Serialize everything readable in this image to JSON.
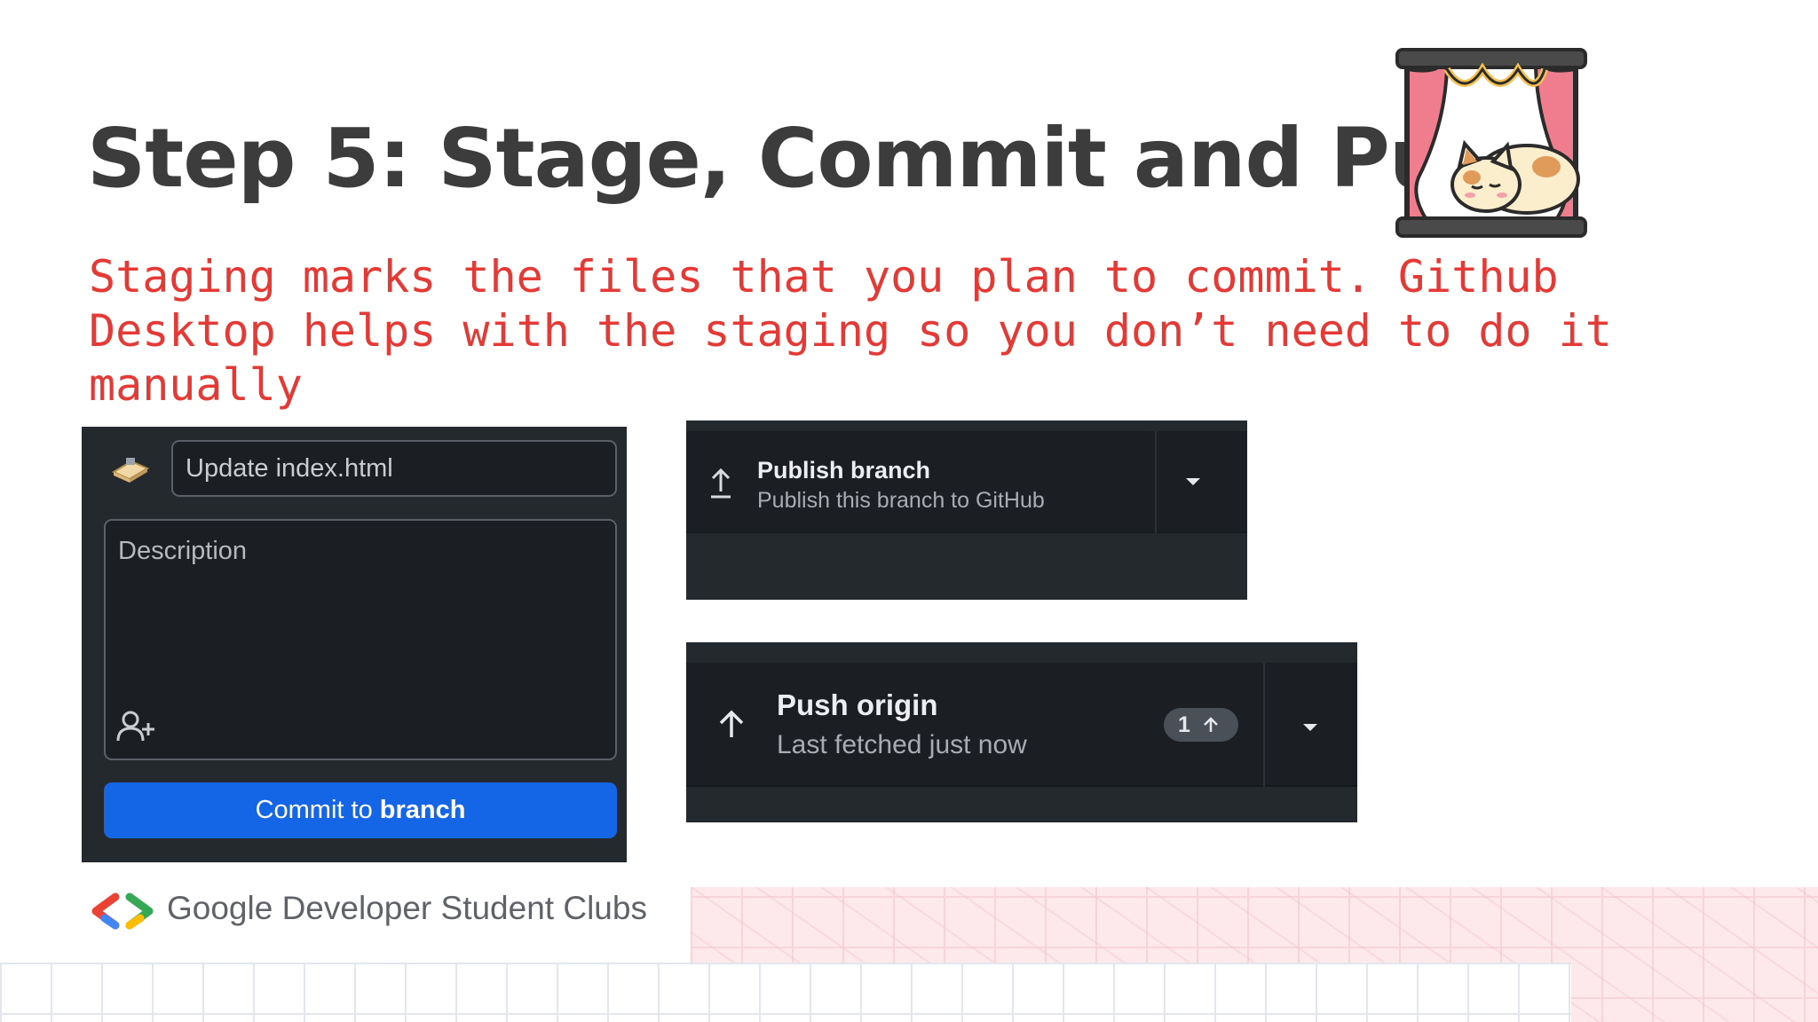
{
  "slide": {
    "title": "Step 5: Stage, Commit and Push",
    "subtitle": "Staging marks the files that you plan to commit. Github Desktop helps with the staging so you don’t need to do it manually"
  },
  "commit_panel": {
    "summary_value": "Update index.html",
    "description_placeholder": "Description",
    "commit_button_prefix": "Commit to ",
    "commit_button_branch": "branch",
    "accent": "#1466e6"
  },
  "publish_panel": {
    "title": "Publish branch",
    "subtitle": "Publish this branch to GitHub"
  },
  "push_panel": {
    "title": "Push origin",
    "subtitle": "Last fetched just now",
    "badge_count": "1"
  },
  "footer": {
    "brand": "Google Developer Student Clubs"
  },
  "icons": [
    "tool-icon",
    "add-coauthor-icon",
    "upload-icon",
    "chevron-down-icon",
    "arrow-up-icon",
    "gdsc-logo-icon",
    "cat-window-illustration"
  ]
}
